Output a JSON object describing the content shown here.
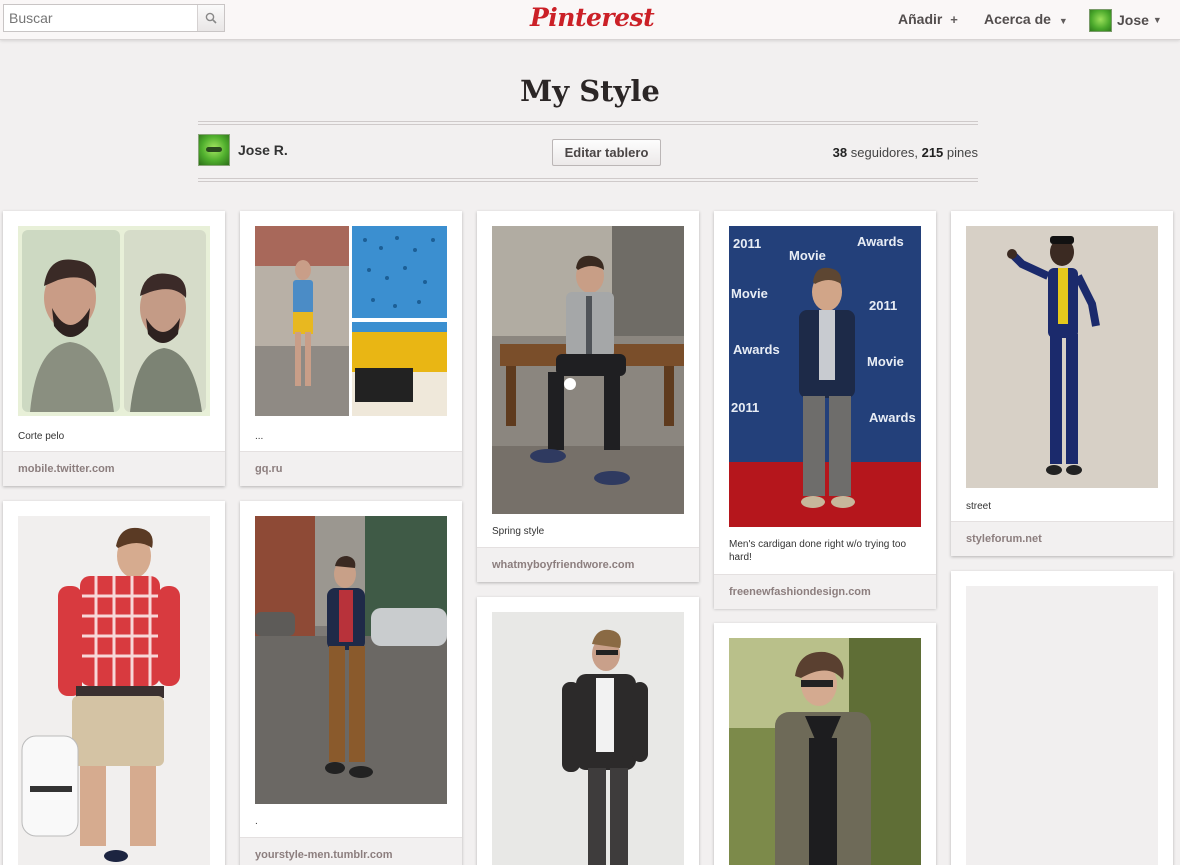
{
  "header": {
    "search_placeholder": "Buscar",
    "logo": "Pinterest",
    "add_label": "Añadir",
    "add_icon": "+",
    "about_label": "Acerca de",
    "user_label": "Jose",
    "caret": "▼",
    "brand_color": "#cb2027"
  },
  "board": {
    "title": "My Style",
    "owner": "Jose R.",
    "edit_button": "Editar tablero",
    "followers_count": "38",
    "followers_label": "seguidores,",
    "pins_count": "215",
    "pins_label": "pines"
  },
  "pins": [
    {
      "description": "Corte pelo",
      "source": "mobile.twitter.com"
    },
    {
      "description": "...",
      "source": "gq.ru"
    },
    {
      "description": "Spring style",
      "source": "whatmyboyfriendwore.com"
    },
    {
      "description": "Men's cardigan done right w/o trying too hard!",
      "source": "freenewfashiondesign.com"
    },
    {
      "description": "street",
      "source": "styleforum.net"
    },
    {
      "description": ".",
      "source": "yourstyle-men.tumblr.com"
    }
  ]
}
